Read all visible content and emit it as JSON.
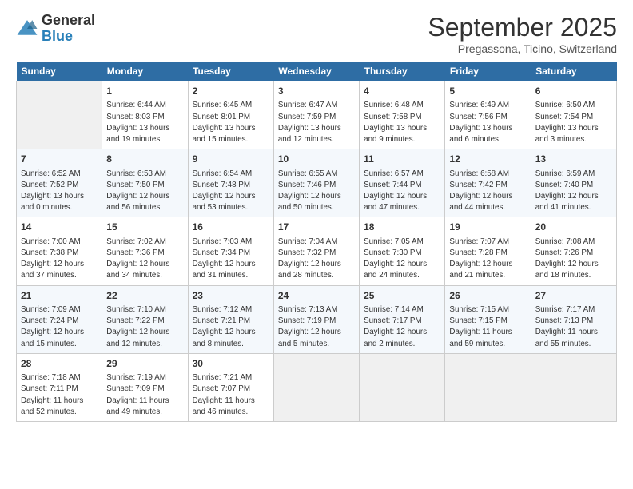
{
  "header": {
    "logo_line1": "General",
    "logo_line2": "Blue",
    "month_title": "September 2025",
    "subtitle": "Pregassona, Ticino, Switzerland"
  },
  "weekdays": [
    "Sunday",
    "Monday",
    "Tuesday",
    "Wednesday",
    "Thursday",
    "Friday",
    "Saturday"
  ],
  "weeks": [
    [
      {
        "day": "",
        "info": ""
      },
      {
        "day": "1",
        "info": "Sunrise: 6:44 AM\nSunset: 8:03 PM\nDaylight: 13 hours\nand 19 minutes."
      },
      {
        "day": "2",
        "info": "Sunrise: 6:45 AM\nSunset: 8:01 PM\nDaylight: 13 hours\nand 15 minutes."
      },
      {
        "day": "3",
        "info": "Sunrise: 6:47 AM\nSunset: 7:59 PM\nDaylight: 13 hours\nand 12 minutes."
      },
      {
        "day": "4",
        "info": "Sunrise: 6:48 AM\nSunset: 7:58 PM\nDaylight: 13 hours\nand 9 minutes."
      },
      {
        "day": "5",
        "info": "Sunrise: 6:49 AM\nSunset: 7:56 PM\nDaylight: 13 hours\nand 6 minutes."
      },
      {
        "day": "6",
        "info": "Sunrise: 6:50 AM\nSunset: 7:54 PM\nDaylight: 13 hours\nand 3 minutes."
      }
    ],
    [
      {
        "day": "7",
        "info": "Sunrise: 6:52 AM\nSunset: 7:52 PM\nDaylight: 13 hours\nand 0 minutes."
      },
      {
        "day": "8",
        "info": "Sunrise: 6:53 AM\nSunset: 7:50 PM\nDaylight: 12 hours\nand 56 minutes."
      },
      {
        "day": "9",
        "info": "Sunrise: 6:54 AM\nSunset: 7:48 PM\nDaylight: 12 hours\nand 53 minutes."
      },
      {
        "day": "10",
        "info": "Sunrise: 6:55 AM\nSunset: 7:46 PM\nDaylight: 12 hours\nand 50 minutes."
      },
      {
        "day": "11",
        "info": "Sunrise: 6:57 AM\nSunset: 7:44 PM\nDaylight: 12 hours\nand 47 minutes."
      },
      {
        "day": "12",
        "info": "Sunrise: 6:58 AM\nSunset: 7:42 PM\nDaylight: 12 hours\nand 44 minutes."
      },
      {
        "day": "13",
        "info": "Sunrise: 6:59 AM\nSunset: 7:40 PM\nDaylight: 12 hours\nand 41 minutes."
      }
    ],
    [
      {
        "day": "14",
        "info": "Sunrise: 7:00 AM\nSunset: 7:38 PM\nDaylight: 12 hours\nand 37 minutes."
      },
      {
        "day": "15",
        "info": "Sunrise: 7:02 AM\nSunset: 7:36 PM\nDaylight: 12 hours\nand 34 minutes."
      },
      {
        "day": "16",
        "info": "Sunrise: 7:03 AM\nSunset: 7:34 PM\nDaylight: 12 hours\nand 31 minutes."
      },
      {
        "day": "17",
        "info": "Sunrise: 7:04 AM\nSunset: 7:32 PM\nDaylight: 12 hours\nand 28 minutes."
      },
      {
        "day": "18",
        "info": "Sunrise: 7:05 AM\nSunset: 7:30 PM\nDaylight: 12 hours\nand 24 minutes."
      },
      {
        "day": "19",
        "info": "Sunrise: 7:07 AM\nSunset: 7:28 PM\nDaylight: 12 hours\nand 21 minutes."
      },
      {
        "day": "20",
        "info": "Sunrise: 7:08 AM\nSunset: 7:26 PM\nDaylight: 12 hours\nand 18 minutes."
      }
    ],
    [
      {
        "day": "21",
        "info": "Sunrise: 7:09 AM\nSunset: 7:24 PM\nDaylight: 12 hours\nand 15 minutes."
      },
      {
        "day": "22",
        "info": "Sunrise: 7:10 AM\nSunset: 7:22 PM\nDaylight: 12 hours\nand 12 minutes."
      },
      {
        "day": "23",
        "info": "Sunrise: 7:12 AM\nSunset: 7:21 PM\nDaylight: 12 hours\nand 8 minutes."
      },
      {
        "day": "24",
        "info": "Sunrise: 7:13 AM\nSunset: 7:19 PM\nDaylight: 12 hours\nand 5 minutes."
      },
      {
        "day": "25",
        "info": "Sunrise: 7:14 AM\nSunset: 7:17 PM\nDaylight: 12 hours\nand 2 minutes."
      },
      {
        "day": "26",
        "info": "Sunrise: 7:15 AM\nSunset: 7:15 PM\nDaylight: 11 hours\nand 59 minutes."
      },
      {
        "day": "27",
        "info": "Sunrise: 7:17 AM\nSunset: 7:13 PM\nDaylight: 11 hours\nand 55 minutes."
      }
    ],
    [
      {
        "day": "28",
        "info": "Sunrise: 7:18 AM\nSunset: 7:11 PM\nDaylight: 11 hours\nand 52 minutes."
      },
      {
        "day": "29",
        "info": "Sunrise: 7:19 AM\nSunset: 7:09 PM\nDaylight: 11 hours\nand 49 minutes."
      },
      {
        "day": "30",
        "info": "Sunrise: 7:21 AM\nSunset: 7:07 PM\nDaylight: 11 hours\nand 46 minutes."
      },
      {
        "day": "",
        "info": ""
      },
      {
        "day": "",
        "info": ""
      },
      {
        "day": "",
        "info": ""
      },
      {
        "day": "",
        "info": ""
      }
    ]
  ]
}
